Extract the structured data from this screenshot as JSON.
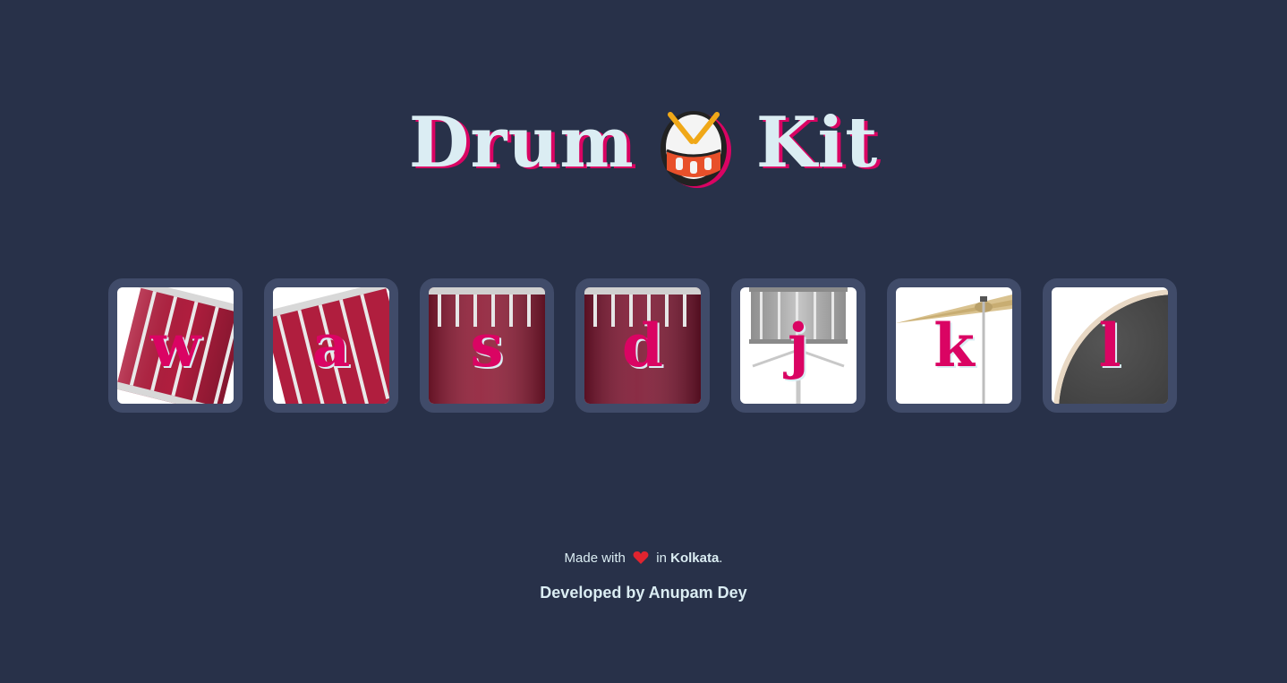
{
  "header": {
    "title_left": "Drum",
    "title_right": "Kit",
    "emoji_icon": "drum-emoji-icon"
  },
  "drums": [
    {
      "key": "w",
      "instrument": "tom-1"
    },
    {
      "key": "a",
      "instrument": "tom-2"
    },
    {
      "key": "s",
      "instrument": "tom-3"
    },
    {
      "key": "d",
      "instrument": "tom-4"
    },
    {
      "key": "j",
      "instrument": "snare"
    },
    {
      "key": "k",
      "instrument": "crash"
    },
    {
      "key": "l",
      "instrument": "kick-bass"
    }
  ],
  "footer": {
    "made_with": "Made with",
    "heart_icon": "heart-icon",
    "in_text": "in",
    "city": "Kolkata",
    "period": ".",
    "developed_by": "Developed by Anupam Dey"
  },
  "colors": {
    "background": "#283149",
    "accent": "#da0463",
    "text": "#dbedf3",
    "tile_border": "#404b69"
  }
}
